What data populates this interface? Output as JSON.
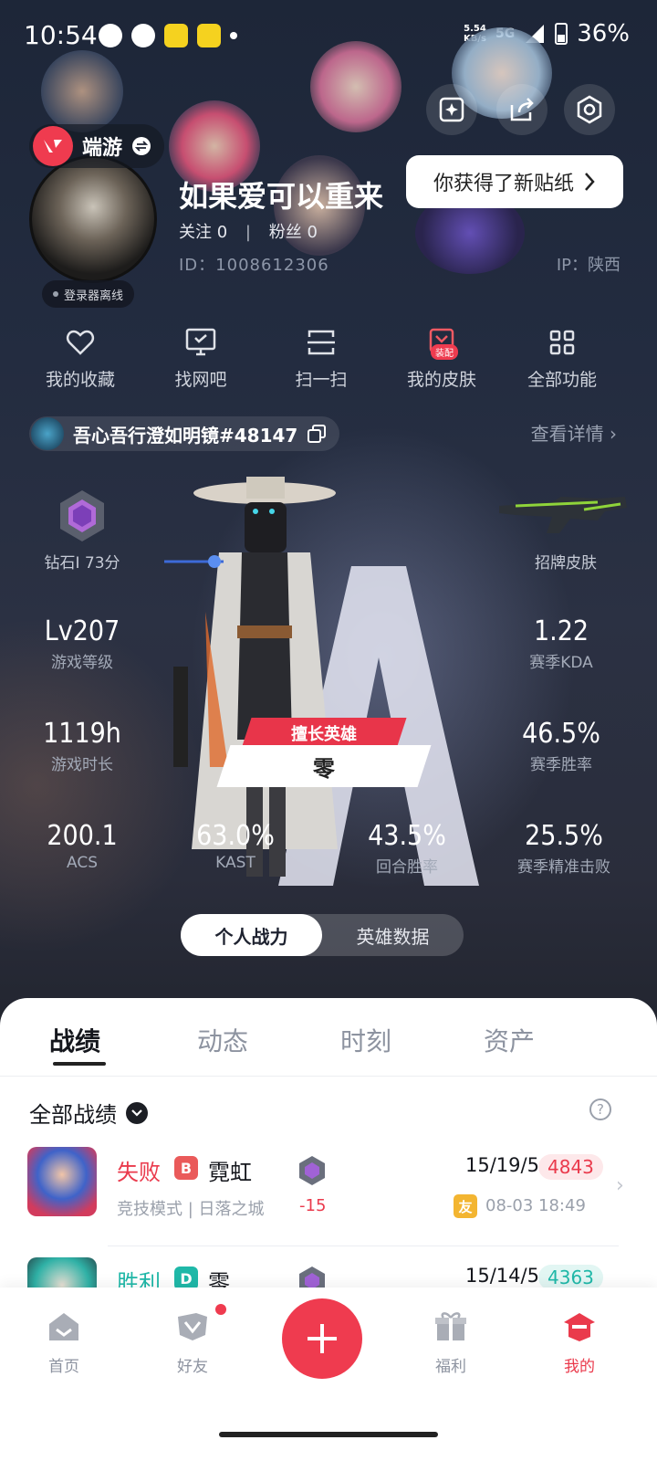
{
  "status_bar": {
    "time": "10:54",
    "net_speed": "5.54",
    "net_unit": "KB/s",
    "network": "5G",
    "battery": "36%"
  },
  "profile": {
    "brand": "端游",
    "status": "登录器离线",
    "name": "如果爱可以重来",
    "follow": "关注 0",
    "divider": "|",
    "fans": "粉丝 0",
    "id": "ID：1008612306",
    "ip": "IP：陕西",
    "sticker_tip": "你获得了新贴纸"
  },
  "quick_actions": [
    {
      "label": "我的收藏",
      "icon": "heart-icon"
    },
    {
      "label": "找网吧",
      "icon": "monitor-icon"
    },
    {
      "label": "扫一扫",
      "icon": "scan-icon"
    },
    {
      "label": "我的皮肤",
      "icon": "skin-icon",
      "badge": "装配"
    },
    {
      "label": "全部功能",
      "icon": "grid-icon"
    }
  ],
  "game_account": {
    "tag": "吾心吾行澄如明镜#48147",
    "details_link": "查看详情"
  },
  "stats": {
    "rank": "钻石I 73分",
    "skin": "招牌皮肤",
    "level_value": "Lv207",
    "level_label": "游戏等级",
    "kda_value": "1.22",
    "kda_label": "赛季KDA",
    "time_value": "1119h",
    "time_label": "游戏时长",
    "winrate_value": "46.5%",
    "winrate_label": "赛季胜率",
    "acs_value": "200.1",
    "acs_label": "ACS",
    "kast_value": "63.0%",
    "kast_label": "KAST",
    "round_value": "43.5%",
    "round_label": "回合胜率",
    "headshot_value": "25.5%",
    "headshot_label": "赛季精准击败",
    "best_agent_tag": "擅长英雄",
    "best_agent": "零",
    "emblem_letter": "A"
  },
  "toggle": {
    "active": "个人战力",
    "inactive": "英雄数据"
  },
  "tabs": [
    "战绩",
    "动态",
    "时刻",
    "资产"
  ],
  "records": {
    "filter": "全部战绩",
    "help": "?",
    "matches": [
      {
        "result": "失败",
        "result_color": "#ea3a4c",
        "grade": "B",
        "grade_color": "#ea5a5a",
        "agent": "霓虹",
        "mode": "竞技模式 | 日落之城",
        "delta": "-15",
        "kda": "15/19/5",
        "score": "4843",
        "score_color": "#ea3a4c",
        "score_bg": "#fde8ea",
        "friend": "友",
        "time": "08-03 18:49"
      },
      {
        "result": "胜利",
        "result_color": "#1fb8a8",
        "grade": "D",
        "grade_color": "#1fb8a8",
        "agent": "零",
        "kda": "15/14/5",
        "score": "4363",
        "score_color": "#1fb8a8",
        "score_bg": "#e2f6f3"
      }
    ]
  },
  "nav": [
    {
      "label": "首页",
      "icon": "home-icon"
    },
    {
      "label": "好友",
      "icon": "friends-icon"
    },
    {
      "label": "福利",
      "icon": "gift-icon"
    },
    {
      "label": "我的",
      "icon": "profile-icon"
    }
  ],
  "colors": {
    "accent": "#ef3b4f",
    "win": "#1fb8a8",
    "loss": "#ea3a4c"
  }
}
